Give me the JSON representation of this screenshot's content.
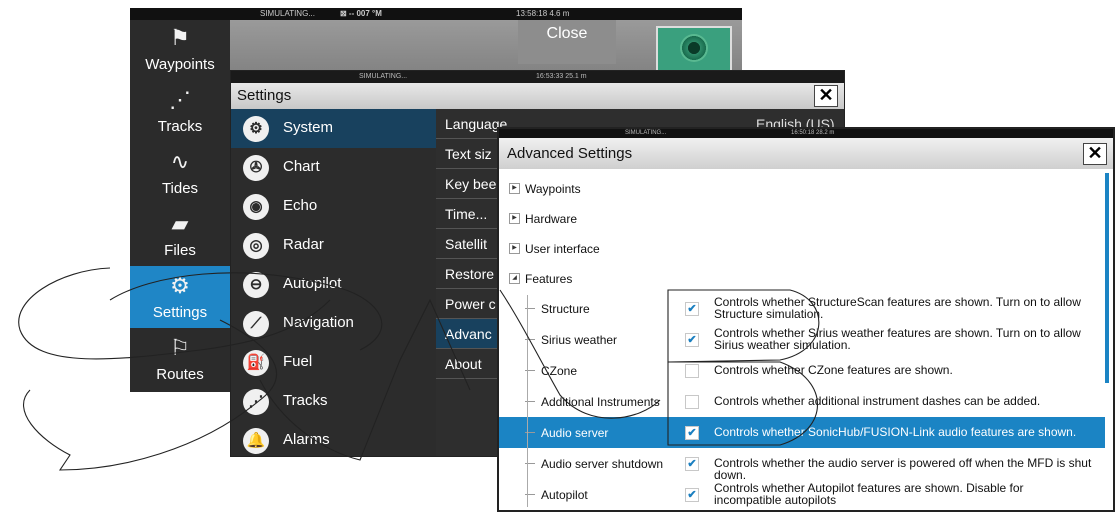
{
  "back_screen": {
    "status_left": "SIMULATING...",
    "status_mid": "⊠ -- 007 °M",
    "status_time": "13:58:18  4.6 m",
    "close_label": "Close",
    "nav": [
      {
        "label": "Waypoints",
        "icon": "waypoints-flag-icon",
        "glyph": "⚑",
        "active": false
      },
      {
        "label": "Tracks",
        "icon": "tracks-icon",
        "glyph": "⋰",
        "active": false
      },
      {
        "label": "Tides",
        "icon": "tides-wave-icon",
        "glyph": "∿",
        "active": false
      },
      {
        "label": "Files",
        "icon": "folder-icon",
        "glyph": "▰",
        "active": false
      },
      {
        "label": "Settings",
        "icon": "gear-icon",
        "glyph": "⚙",
        "active": true
      },
      {
        "label": "Routes",
        "icon": "routes-icon",
        "glyph": "⚐",
        "active": false
      }
    ]
  },
  "settings": {
    "status_left": "SIMULATING...",
    "status_time": "16:53:33  25.1 m",
    "title": "Settings",
    "close_glyph": "✕",
    "items": [
      {
        "label": "System",
        "icon": "system-gear-icon",
        "glyph": "⚙",
        "active": true
      },
      {
        "label": "Chart",
        "icon": "chart-icon",
        "glyph": "✇",
        "active": false
      },
      {
        "label": "Echo",
        "icon": "echo-icon",
        "glyph": "◉",
        "active": false
      },
      {
        "label": "Radar",
        "icon": "radar-icon",
        "glyph": "◎",
        "active": false
      },
      {
        "label": "Autopilot",
        "icon": "autopilot-wheel-icon",
        "glyph": "⊖",
        "active": false
      },
      {
        "label": "Navigation",
        "icon": "navigation-compass-icon",
        "glyph": "⟋",
        "active": false
      },
      {
        "label": "Fuel",
        "icon": "fuel-pump-icon",
        "glyph": "⛽",
        "active": false
      },
      {
        "label": "Tracks",
        "icon": "tracks-icon",
        "glyph": "⋰",
        "active": false
      },
      {
        "label": "Alarms",
        "icon": "alarm-bell-icon",
        "glyph": "🔔",
        "active": false
      }
    ],
    "options": [
      {
        "label": "Language",
        "value": "English (US)",
        "active": false
      },
      {
        "label": "Text siz",
        "active": false
      },
      {
        "label": "Key bee",
        "active": false
      },
      {
        "label": "Time...",
        "active": false
      },
      {
        "label": "Satellit",
        "active": false
      },
      {
        "label": "Restore",
        "active": false
      },
      {
        "label": "Power c",
        "active": false
      },
      {
        "label": "Advanc",
        "active": true
      },
      {
        "label": "About",
        "active": false
      }
    ]
  },
  "advanced": {
    "status_left": "SIMULATING...",
    "status_time": "16:50:18  28.2 m",
    "title": "Advanced Settings",
    "close_glyph": "✕",
    "groups": [
      {
        "label": "Waypoints",
        "expanded": false
      },
      {
        "label": "Hardware",
        "expanded": false
      },
      {
        "label": "User interface",
        "expanded": false
      },
      {
        "label": "Features",
        "expanded": true
      }
    ],
    "features": [
      {
        "name": "Structure",
        "checked": true,
        "desc": "Controls whether StructureScan features are shown. Turn on to allow Structure simulation.",
        "active": false
      },
      {
        "name": "Sirius weather",
        "checked": true,
        "desc": "Controls whether Sirius weather features are shown. Turn on to allow Sirius weather simulation.",
        "active": false
      },
      {
        "name": "CZone",
        "checked": false,
        "desc": "Controls whether CZone features are shown.",
        "active": false
      },
      {
        "name": "Additional Instruments",
        "checked": false,
        "desc": "Controls whether additional instrument dashes can be added.",
        "active": false
      },
      {
        "name": "Audio server",
        "checked": true,
        "desc": "Controls whether SonicHub/FUSION-Link audio features are shown.",
        "active": true
      },
      {
        "name": "Audio server shutdown",
        "checked": true,
        "desc": "Controls whether the audio server is powered off when the MFD is shut down.",
        "active": false
      },
      {
        "name": "Autopilot",
        "checked": true,
        "desc": "Controls whether Autopilot features are shown. Disable for incompatible autopilots",
        "active": false
      }
    ]
  }
}
